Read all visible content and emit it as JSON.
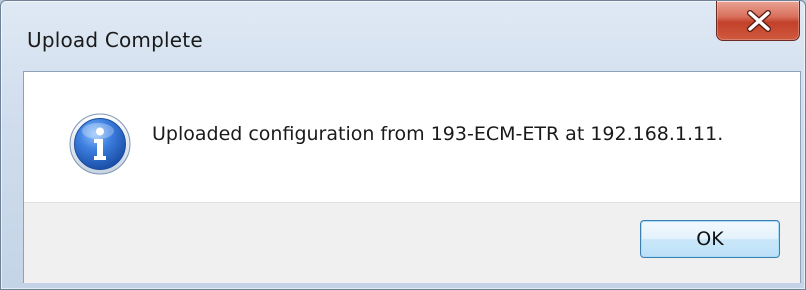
{
  "dialog": {
    "title": "Upload Complete",
    "message": "Uploaded configuration from 193-ECM-ETR at 192.168.1.11.",
    "icon": "info-icon",
    "ok_label": "OK",
    "close_icon": "close-icon"
  },
  "colors": {
    "close_button": "#c94a32",
    "ok_border": "#3c7fb1",
    "info_icon": "#2f6fd0"
  }
}
